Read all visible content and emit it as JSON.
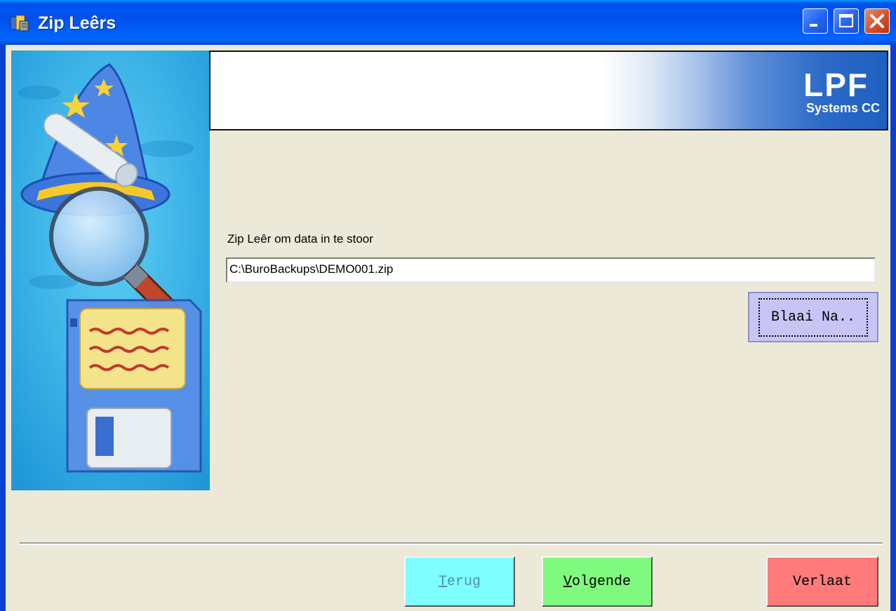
{
  "window": {
    "title": "Zip Leêrs"
  },
  "banner": {
    "logo_main": "LPF",
    "logo_sub": "Systems CC"
  },
  "form": {
    "label": "Zip Leêr om data in te stoor",
    "path_value": "C:\\BuroBackups\\DEMO001.zip",
    "browse_label": "Blaai Na.."
  },
  "buttons": {
    "back_first": "T",
    "back_rest": "erug",
    "next_first": "V",
    "next_rest": "olgende",
    "exit_label": "Verlaat"
  },
  "colors": {
    "back_button": "#7FFFFF",
    "next_button": "#7EFB7E",
    "exit_button": "#FF7B7B",
    "browse_button": "#C7C5F6",
    "titlebar": "#0053EE"
  },
  "icons": {
    "window_icon": "app-icon",
    "wizard_graphic": "wizard-hat-floppy-illustration"
  }
}
